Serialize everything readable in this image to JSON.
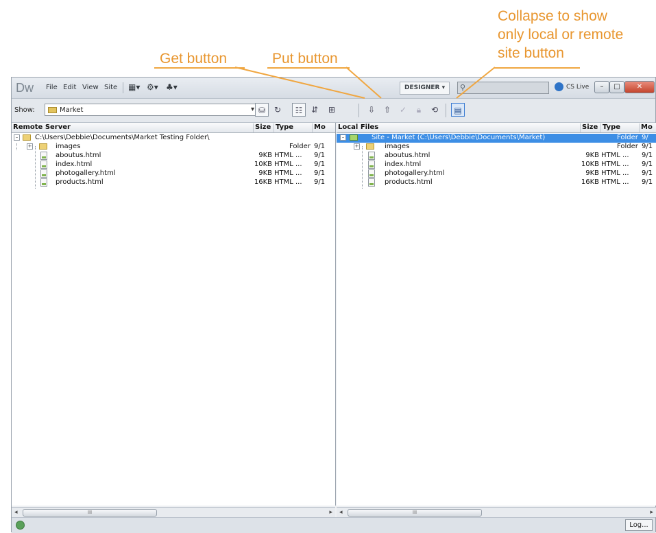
{
  "callouts": {
    "get_button": "Get button",
    "put_button": "Put button",
    "collapse": "Collapse to show\nonly local or remote\nsite button"
  },
  "app": {
    "logo": "Dw",
    "menus": [
      "File",
      "Edit",
      "View",
      "Site"
    ],
    "workspace": "DESIGNER ▾",
    "cs_live": "CS Live",
    "window_buttons": [
      "–",
      "□",
      "✕"
    ]
  },
  "toolbar": {
    "show_label": "Show:",
    "site_select_value": "Market"
  },
  "remote": {
    "columns": [
      "Remote Server",
      "Size",
      "Type",
      "Mo"
    ],
    "root": "C:\\Users\\Debbie\\Documents\\Market Testing Folder\\",
    "rows": [
      {
        "name": "images",
        "size": "",
        "type": "Folder",
        "modified": "9/1"
      },
      {
        "name": "aboutus.html",
        "size": "9KB",
        "type": "HTML ...",
        "modified": "9/1"
      },
      {
        "name": "index.html",
        "size": "10KB",
        "type": "HTML ...",
        "modified": "9/1"
      },
      {
        "name": "photogallery.html",
        "size": "9KB",
        "type": "HTML ...",
        "modified": "9/1"
      },
      {
        "name": "products.html",
        "size": "16KB",
        "type": "HTML ...",
        "modified": "9/1"
      }
    ]
  },
  "local": {
    "columns": [
      "Local Files",
      "Size",
      "Type",
      "Mo"
    ],
    "root": {
      "name": "Site - Market (C:\\Users\\Debbie\\Documents\\Market)",
      "type": "Folder",
      "modified": "9/"
    },
    "rows": [
      {
        "name": "images",
        "size": "",
        "type": "Folder",
        "modified": "9/1"
      },
      {
        "name": "aboutus.html",
        "size": "9KB",
        "type": "HTML ...",
        "modified": "9/1"
      },
      {
        "name": "index.html",
        "size": "10KB",
        "type": "HTML ...",
        "modified": "9/1"
      },
      {
        "name": "photogallery.html",
        "size": "9KB",
        "type": "HTML ...",
        "modified": "9/1"
      },
      {
        "name": "products.html",
        "size": "16KB",
        "type": "HTML ...",
        "modified": "9/1"
      }
    ]
  },
  "scrollbar_thumb": "III",
  "status": {
    "log_button": "Log..."
  },
  "colors": {
    "callout": "#e8962f",
    "selection": "#3d8ee5"
  }
}
